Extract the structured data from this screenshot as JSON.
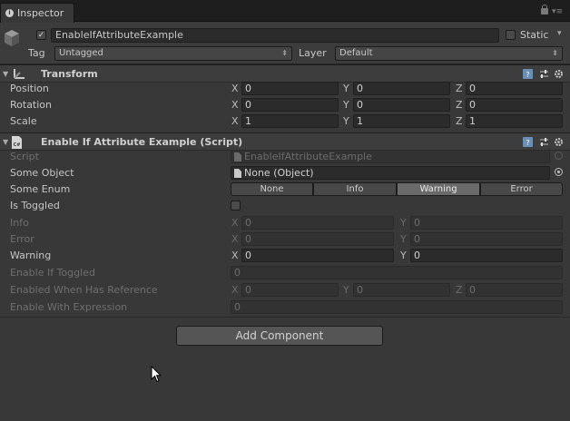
{
  "tab": {
    "label": "Inspector",
    "icon": "info-icon"
  },
  "header": {
    "active": true,
    "object_name": "EnableIfAttributeExample",
    "static_label": "Static",
    "tag_label": "Tag",
    "tag_value": "Untagged",
    "layer_label": "Layer",
    "layer_value": "Default"
  },
  "transform": {
    "title": "Transform",
    "rows": [
      {
        "label": "Position",
        "x": "0",
        "y": "0",
        "z": "0"
      },
      {
        "label": "Rotation",
        "x": "0",
        "y": "0",
        "z": "0"
      },
      {
        "label": "Scale",
        "x": "1",
        "y": "1",
        "z": "1"
      }
    ]
  },
  "axes": {
    "x": "X",
    "y": "Y",
    "z": "Z"
  },
  "script_component": {
    "title": "Enable If Attribute Example (Script)",
    "script_label": "Script",
    "script_value": "EnableIfAttributeExample",
    "some_object_label": "Some Object",
    "some_object_value": "None (Object)",
    "some_enum_label": "Some Enum",
    "enum_options": [
      "None",
      "Info",
      "Warning",
      "Error"
    ],
    "enum_selected": "Warning",
    "is_toggled_label": "Is Toggled",
    "is_toggled": false,
    "info_label": "Info",
    "info_x": "0",
    "info_y": "0",
    "error_label": "Error",
    "error_x": "0",
    "error_y": "0",
    "warning_label": "Warning",
    "warning_x": "0",
    "warning_y": "0",
    "enable_if_toggled_label": "Enable If Toggled",
    "enable_if_toggled_value": "0",
    "enabled_ref_label": "Enabled When Has Reference",
    "enabled_ref_x": "0",
    "enabled_ref_y": "0",
    "enabled_ref_z": "0",
    "enable_expr_label": "Enable With Expression",
    "enable_expr_value": "0"
  },
  "add_component_label": "Add Component",
  "colors": {
    "panel": "#383838",
    "field": "#2b2b2b",
    "selected_segment": "#6a6a6a"
  }
}
